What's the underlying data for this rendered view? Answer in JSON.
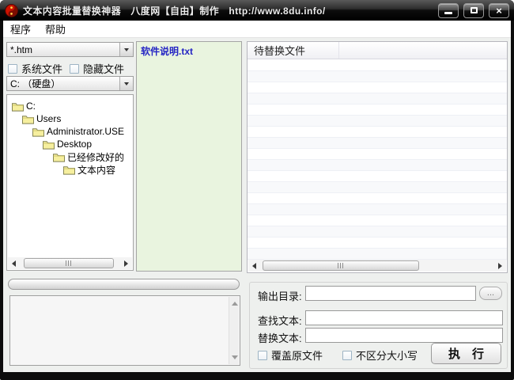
{
  "window": {
    "title": "文本内容批量替换神器　八度网【自由】制作　http://www.8du.info/",
    "icons": {
      "app": "taiji-icon",
      "minimize": "minimize-icon",
      "maximize": "maximize-icon",
      "close": "close-icon",
      "folder": "folder-icon",
      "dropdown": "chevron-down-icon"
    }
  },
  "menu": {
    "program": "程序",
    "help": "帮助"
  },
  "filters": {
    "pattern_combo": {
      "value": "*.htm"
    },
    "system_files_checkbox": {
      "label": "系统文件",
      "checked": false
    },
    "hidden_files_checkbox": {
      "label": "隐藏文件",
      "checked": false
    },
    "drive_combo": {
      "value": "C: （硬盘）"
    }
  },
  "folder_tree": {
    "items": [
      {
        "label": "C:"
      },
      {
        "label": "Users"
      },
      {
        "label": "Administrator.USE"
      },
      {
        "label": "Desktop"
      },
      {
        "label": "已经修改好的"
      },
      {
        "label": "文本内容"
      }
    ]
  },
  "file_list": {
    "items": [
      {
        "name": "软件说明.txt"
      }
    ]
  },
  "target_list": {
    "header": "待替换文件",
    "rows": []
  },
  "progress": {
    "value": 0
  },
  "log": {
    "text": ""
  },
  "actions": {
    "output_dir_label": "输出目录:",
    "output_dir_value": "",
    "browse_label": "...",
    "find_label": "查找文本:",
    "find_value": "",
    "replace_label": "替换文本:",
    "replace_value": "",
    "overwrite_checkbox": {
      "label": "覆盖原文件",
      "checked": false
    },
    "ignore_case_checkbox": {
      "label": "不区分大小写",
      "checked": false
    },
    "execute_label": "执　行"
  },
  "colors": {
    "titlebar": "#1a1a1a",
    "client_bg": "#eef0ee",
    "filelist_bg": "#e9f4df",
    "file_text": "#2424c4"
  }
}
